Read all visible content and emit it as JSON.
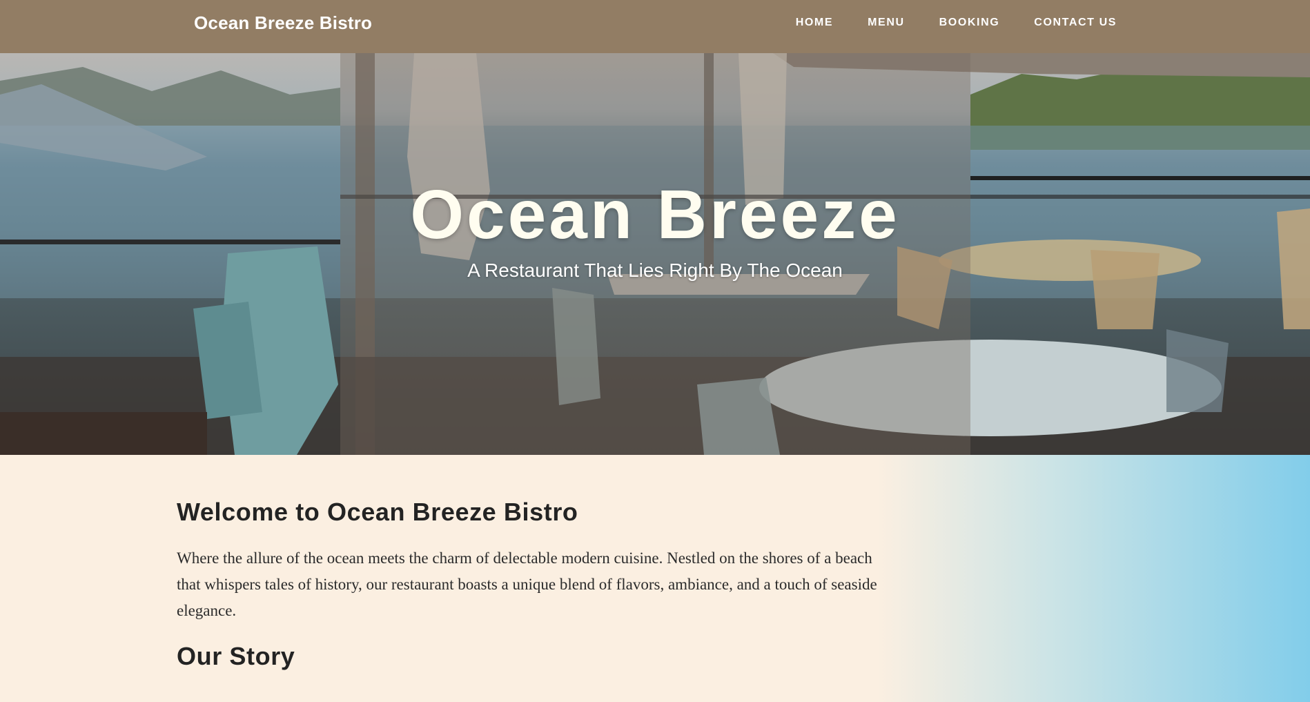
{
  "nav": {
    "brand": "Ocean Breeze Bistro",
    "links": [
      "HOME",
      "MENU",
      "BOOKING",
      "CONTACT US"
    ]
  },
  "hero": {
    "title": "Ocean Breeze",
    "subtitle": "A Restaurant That Lies Right By The Ocean"
  },
  "content": {
    "welcome_heading": "Welcome to Ocean Breeze Bistro",
    "intro": "Where the allure of the ocean meets the charm of delectable modern cuisine. Nestled on the shores of a beach that whispers tales of history, our restaurant boasts a unique blend of flavors, ambiance, and a touch of seaside elegance.",
    "story_heading": "Our Story"
  },
  "colors": {
    "nav_bg": "#927d64",
    "page_bg": "#fbefe1",
    "gradient_end": "#82cdea",
    "hero_title": "#fffdf0"
  }
}
